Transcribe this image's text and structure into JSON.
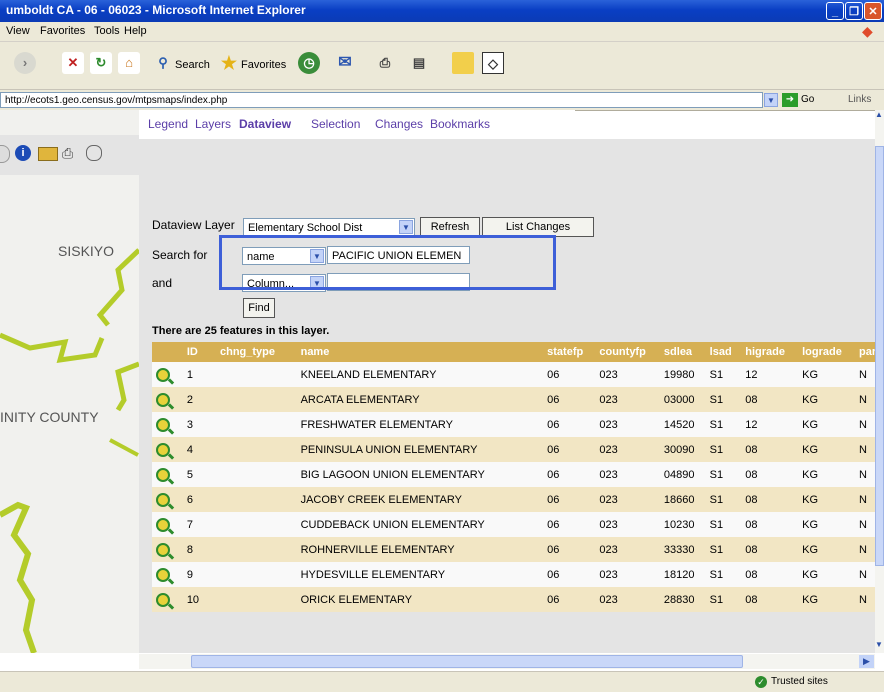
{
  "window": {
    "title": "umboldt CA - 06 - 06023 - Microsoft Internet Explorer"
  },
  "menu": [
    "View",
    "Favorites",
    "Tools",
    "Help"
  ],
  "toolbar": {
    "search_label": "Search",
    "favorites_label": "Favorites"
  },
  "address": {
    "url": "http://ecots1.geo.census.gov/mtpsmaps/index.php",
    "go_label": "Go",
    "links_label": "Links"
  },
  "nav_tabs": [
    "Legend",
    "Layers",
    "Dataview",
    "Selection",
    "Changes",
    "Bookmarks"
  ],
  "active_tab": "Dataview",
  "map": {
    "label_top": "SISKIYO",
    "label_mid": "INITY COUNTY"
  },
  "dataview": {
    "layer_label": "Dataview Layer",
    "layer_value": "Elementary School Dist",
    "refresh_label": "Refresh",
    "list_changes_label": "List Changes",
    "search_for_label": "Search for",
    "search_field": "name",
    "search_value": "PACIFIC UNION ELEMEN",
    "and_label": "and",
    "and_field": "Column...",
    "and_value": "",
    "find_label": "Find",
    "feature_count_text": "There are 25 features in this layer."
  },
  "table": {
    "columns": [
      "ID",
      "chng_type",
      "name",
      "statefp",
      "countyfp",
      "sdlea",
      "lsad",
      "higrade",
      "lograde",
      "partflg"
    ],
    "rows": [
      [
        "1",
        "",
        "KNEELAND ELEMENTARY",
        "06",
        "023",
        "19980",
        "S1",
        "12",
        "KG",
        "N"
      ],
      [
        "2",
        "",
        "ARCATA ELEMENTARY",
        "06",
        "023",
        "03000",
        "S1",
        "08",
        "KG",
        "N"
      ],
      [
        "3",
        "",
        "FRESHWATER ELEMENTARY",
        "06",
        "023",
        "14520",
        "S1",
        "12",
        "KG",
        "N"
      ],
      [
        "4",
        "",
        "PENINSULA UNION ELEMENTARY",
        "06",
        "023",
        "30090",
        "S1",
        "08",
        "KG",
        "N"
      ],
      [
        "5",
        "",
        "BIG LAGOON UNION ELEMENTARY",
        "06",
        "023",
        "04890",
        "S1",
        "08",
        "KG",
        "N"
      ],
      [
        "6",
        "",
        "JACOBY CREEK ELEMENTARY",
        "06",
        "023",
        "18660",
        "S1",
        "08",
        "KG",
        "N"
      ],
      [
        "7",
        "",
        "CUDDEBACK UNION ELEMENTARY",
        "06",
        "023",
        "10230",
        "S1",
        "08",
        "KG",
        "N"
      ],
      [
        "8",
        "",
        "ROHNERVILLE ELEMENTARY",
        "06",
        "023",
        "33330",
        "S1",
        "08",
        "KG",
        "N"
      ],
      [
        "9",
        "",
        "HYDESVILLE ELEMENTARY",
        "06",
        "023",
        "18120",
        "S1",
        "08",
        "KG",
        "N"
      ],
      [
        "10",
        "",
        "ORICK ELEMENTARY",
        "06",
        "023",
        "28830",
        "S1",
        "08",
        "KG",
        "N"
      ]
    ]
  },
  "status": {
    "zone": "Trusted sites"
  },
  "colors": {
    "accent_highlight": "#3d5fd8",
    "header_bg": "#d6b054",
    "nav_link": "#5b3ea8"
  }
}
